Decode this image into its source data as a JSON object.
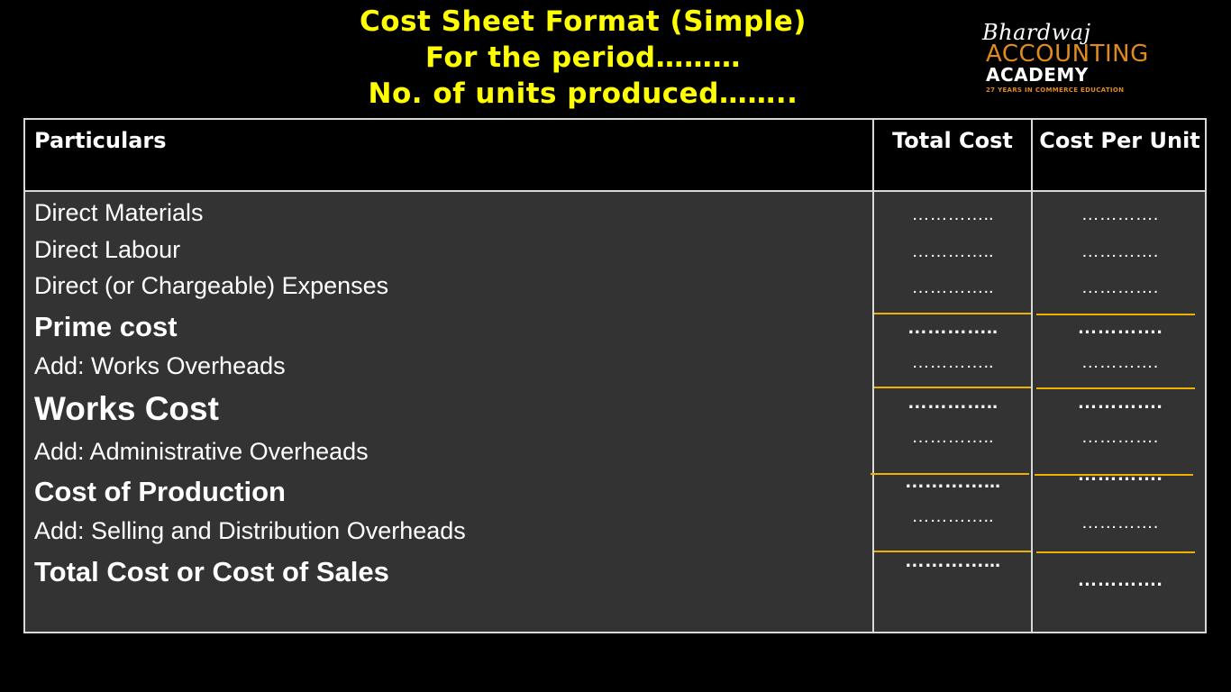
{
  "title": {
    "line1": "Cost Sheet Format (Simple)",
    "line2": "For the period………",
    "line3": "No. of units produced……..",
    "color": "#ffff00"
  },
  "logo": {
    "script": "Bhardwaj",
    "name": "ACCOUNTING",
    "academy": "ACADEMY",
    "tagline": "27 YEARS IN COMMERCE EDUCATION",
    "accent": "#e08a1e"
  },
  "table": {
    "headers": {
      "particulars": "Particulars",
      "total_cost": "Total Cost",
      "cost_per_unit": "Cost Per Unit"
    },
    "rows": [
      {
        "label": "Direct Materials",
        "style": "normal",
        "total": "…………..",
        "per_unit": "…………."
      },
      {
        "label": "Direct Labour",
        "style": "normal",
        "total": "…………..",
        "per_unit": "…………."
      },
      {
        "label": "Direct (or Chargeable) Expenses",
        "style": "normal",
        "total": "…………..",
        "per_unit": "…………."
      },
      {
        "label": "Prime cost",
        "style": "subtotal",
        "total": "…………..",
        "per_unit": "…………."
      },
      {
        "label": "Add: Works Overheads",
        "style": "normal",
        "total": "…………..",
        "per_unit": "…………."
      },
      {
        "label": "Works Cost",
        "style": "subtotal",
        "total": "…………..",
        "per_unit": "…………."
      },
      {
        "label": "Add: Administrative Overheads",
        "style": "normal",
        "total": "…………..",
        "per_unit": "…………."
      },
      {
        "label": "Cost of Production",
        "style": "subtotal",
        "total": "…………...",
        "per_unit": "…………."
      },
      {
        "label": "Add: Selling and Distribution Overheads",
        "style": "normal",
        "total": "…………..",
        "per_unit": "…………."
      },
      {
        "label": "Total Cost or Cost of Sales",
        "style": "total",
        "total": "…………...",
        "per_unit": "…………."
      }
    ],
    "rule_color": "#f0b000"
  }
}
